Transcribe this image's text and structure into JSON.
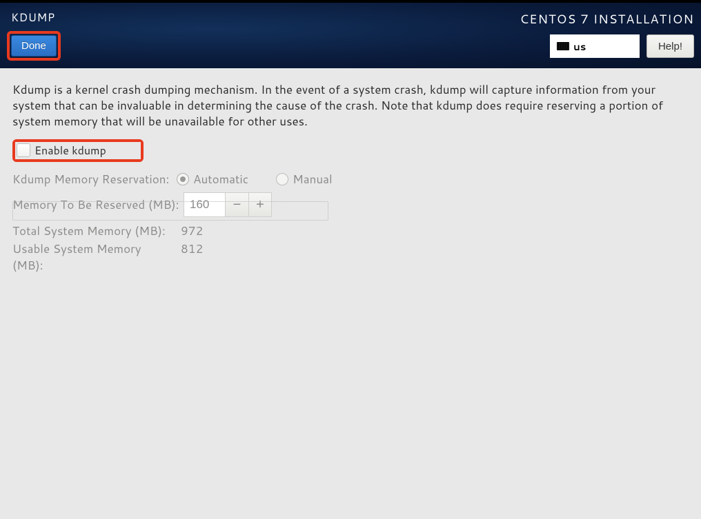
{
  "header": {
    "page_title": "KDUMP",
    "done_label": "Done",
    "install_title": "CENTOS 7 INSTALLATION",
    "keyboard_layout": "us",
    "help_label": "Help!"
  },
  "content": {
    "description": "Kdump is a kernel crash dumping mechanism. In the event of a system crash, kdump will capture information from your system that can be invaluable in determining the cause of the crash. Note that kdump does require reserving a portion of system memory that will be unavailable for other uses.",
    "enable_label": "Enable kdump",
    "enable_checked": false,
    "reservation": {
      "label": "Kdump Memory Reservation:",
      "auto_label": "Automatic",
      "manual_label": "Manual",
      "selected": "automatic"
    },
    "memory_to_reserve": {
      "label": "Memory To Be Reserved (MB):",
      "value": "160"
    },
    "total_memory": {
      "label": "Total System Memory (MB):",
      "value": "972"
    },
    "usable_memory": {
      "label": "Usable System Memory (MB):",
      "value": "812"
    }
  }
}
